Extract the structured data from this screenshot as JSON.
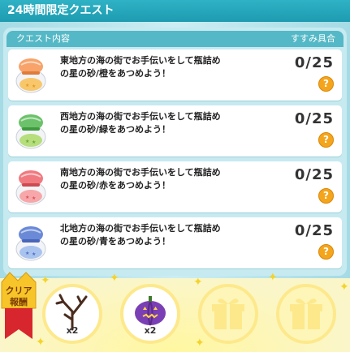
{
  "window": {
    "title": "24時間限定クエスト"
  },
  "header": {
    "content_label": "クエスト内容",
    "progress_label": "すすみ具合"
  },
  "quests": [
    {
      "text": "東地方の海の街でお手伝いをして瓶詰めの星の砂/橙をあつめよう！",
      "progress": "0/25",
      "jar_color": "#f7a36a",
      "sand_color": "#f9c76b",
      "icon": "star-sand-jar-orange-icon"
    },
    {
      "text": "西地方の海の街でお手伝いをして瓶詰めの星の砂/緑をあつめよう！",
      "progress": "0/25",
      "jar_color": "#6cc26a",
      "sand_color": "#b6de7c",
      "icon": "star-sand-jar-green-icon"
    },
    {
      "text": "南地方の海の街でお手伝いをして瓶詰めの星の砂/赤をあつめよう！",
      "progress": "0/25",
      "jar_color": "#f07a80",
      "sand_color": "#f7a7a9",
      "icon": "star-sand-jar-red-icon"
    },
    {
      "text": "北地方の海の街でお手伝いをして瓶詰めの星の砂/青をあつめよう！",
      "progress": "0/25",
      "jar_color": "#6a8ad8",
      "sand_color": "#a9c3ef",
      "icon": "star-sand-jar-blue-icon"
    }
  ],
  "help_glyph": "?",
  "reward": {
    "badge_line1": "クリア",
    "badge_line2": "報酬",
    "items": [
      {
        "icon": "dead-tree-branch-icon",
        "count": "x2"
      },
      {
        "icon": "purple-pumpkin-icon",
        "count": "x2"
      },
      {
        "icon": "gift-box-icon",
        "count": ""
      },
      {
        "icon": "gift-box-icon",
        "count": ""
      }
    ]
  }
}
